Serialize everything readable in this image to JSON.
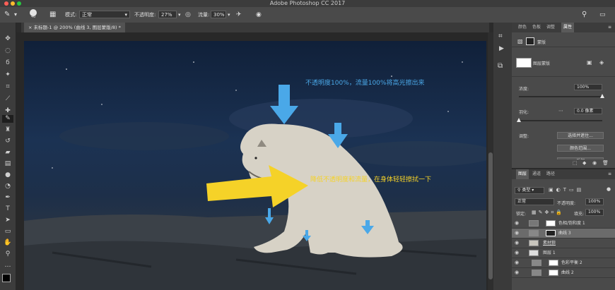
{
  "window": {
    "title": "Adobe Photoshop CC 2017"
  },
  "options_bar": {
    "brush_size": "40",
    "mode_label": "模式:",
    "mode_value": "正常",
    "opacity_label": "不透明度:",
    "opacity_value": "27%",
    "flow_label": "流量:",
    "flow_value": "30%"
  },
  "document_tab": {
    "label": "未标题-1 @ 200% (曲线 3, 图层蒙版/8) *"
  },
  "canvas": {
    "annotation_top": "不透明度100%，流量100%将高光擦出来",
    "annotation_bottom": "降低不透明度和流量，在身体轻轻擦拭一下"
  },
  "properties_panel": {
    "tabs": [
      "颜色",
      "色板",
      "调整",
      "属性"
    ],
    "active_tab": "属性",
    "mask_label": "蒙版",
    "layer_mask_label": "图层蒙版",
    "density_label": "浓度:",
    "density_value": "100%",
    "feather_label": "羽化:",
    "feather_value": "0.0 像素",
    "adjust_label": "调整:",
    "select_mask_button": "选择并遮住...",
    "color_range_button": "颜色范围...",
    "invert_button": "反相"
  },
  "layers_panel": {
    "tabs": [
      "图层",
      "通道",
      "路径"
    ],
    "filter_label": "类型",
    "blend_mode": "正常",
    "opacity_label": "不透明度:",
    "opacity_value": "100%",
    "lock_label": "锁定:",
    "fill_label": "填充:",
    "fill_value": "100%",
    "layers": [
      {
        "name": "色相/饱和度 1",
        "selected": false
      },
      {
        "name": "曲线 3",
        "selected": true
      },
      {
        "name": "素材狼",
        "selected": false
      },
      {
        "name": "图层 1",
        "selected": false
      },
      {
        "name": "色彩平衡 2",
        "selected": false
      },
      {
        "name": "曲线 2",
        "selected": false
      }
    ]
  },
  "colors": {
    "annotation_blue": "#4aa8e8",
    "annotation_yellow": "#f5d228",
    "annotation_top_text": "#4aa8e8",
    "annotation_bottom_text": "#f5d228"
  }
}
